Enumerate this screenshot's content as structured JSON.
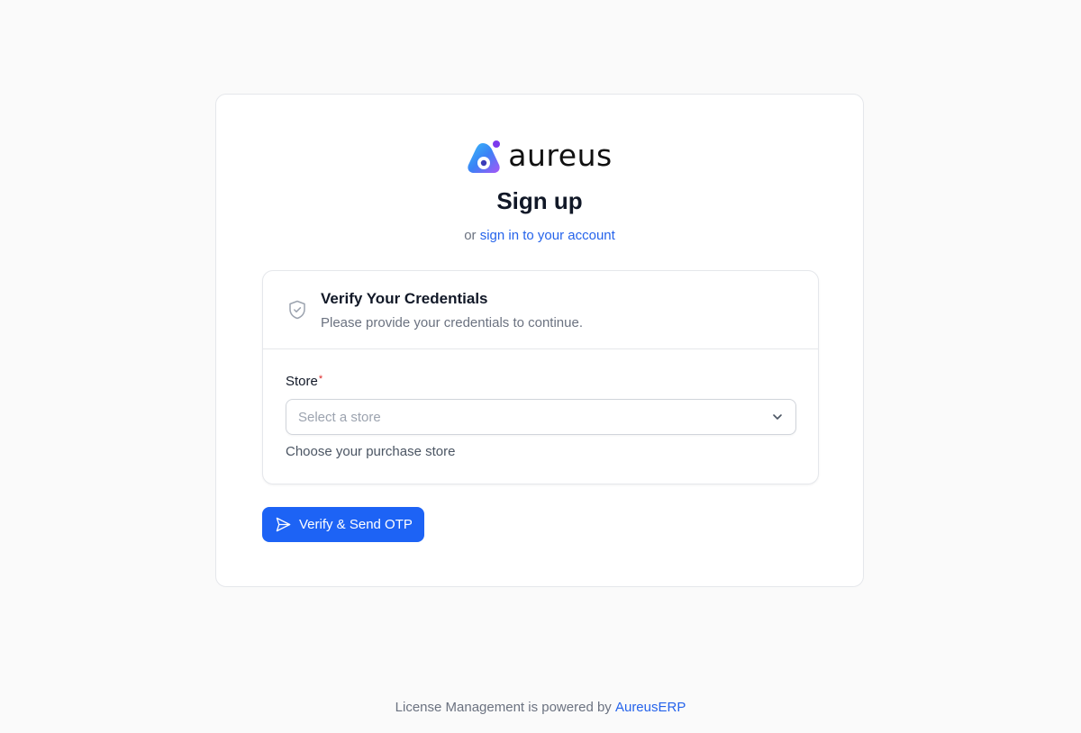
{
  "brand": {
    "name": "aureus",
    "colors": {
      "primary": "#1d63f5",
      "link": "#2563eb",
      "logo_start": "#3b82f6",
      "logo_end": "#a855f7"
    }
  },
  "header": {
    "title": "Sign up",
    "prefix": "or",
    "signin_link": "sign in to your account"
  },
  "section": {
    "icon": "shield-check-icon",
    "title": "Verify Your Credentials",
    "description": "Please provide your credentials to continue."
  },
  "form": {
    "store": {
      "label": "Store",
      "required_mark": "*",
      "placeholder": "Select a store",
      "helper": "Choose your purchase store"
    }
  },
  "actions": {
    "submit_label": "Verify & Send OTP",
    "submit_icon": "send-icon"
  },
  "footer": {
    "text": "License Management is powered by",
    "link": "AureusERP"
  }
}
